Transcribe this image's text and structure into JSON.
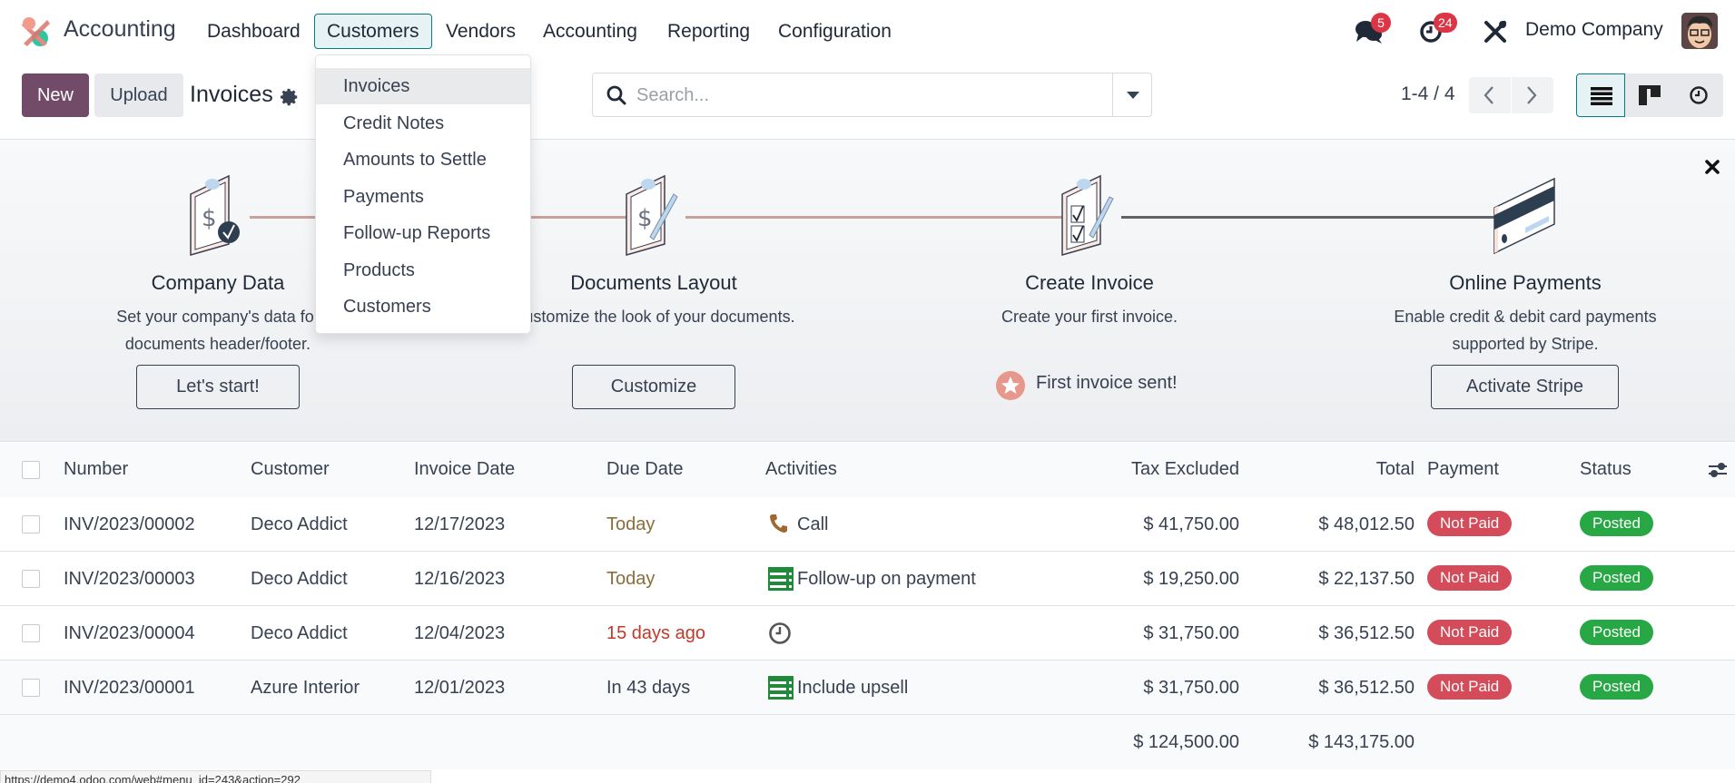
{
  "navbar": {
    "app_name": "Accounting",
    "menu": [
      {
        "label": "Dashboard",
        "active": false
      },
      {
        "label": "Customers",
        "active": true
      },
      {
        "label": "Vendors",
        "active": false
      },
      {
        "label": "Accounting",
        "active": false
      },
      {
        "label": "Reporting",
        "active": false
      },
      {
        "label": "Configuration",
        "active": false
      }
    ],
    "messages_icon": "chat-bubbles-icon",
    "messages_count": "5",
    "activities_icon": "clock-icon",
    "activities_count": "24",
    "debug_icon": "tools-icon",
    "company": "Demo Company"
  },
  "customers_menu": {
    "items": [
      {
        "label": "Invoices",
        "active": true
      },
      {
        "label": "Credit Notes"
      },
      {
        "label": "Amounts to Settle"
      },
      {
        "label": "Payments"
      },
      {
        "label": "Follow-up Reports"
      },
      {
        "label": "Products"
      },
      {
        "label": "Customers"
      }
    ]
  },
  "control_panel": {
    "new_label": "New",
    "upload_label": "Upload",
    "title": "Invoices",
    "search_placeholder": "Search...",
    "pager": "1-4 / 4",
    "views": [
      "list",
      "kanban",
      "activity"
    ]
  },
  "banner": {
    "steps": [
      {
        "title": "Company Data",
        "desc": "Set your company's data for documents header/footer.",
        "button": "Let's start!"
      },
      {
        "title": "Documents Layout",
        "desc": "Customize the look of your documents.",
        "button": "Customize"
      },
      {
        "title": "Create Invoice",
        "desc": "Create your first invoice.",
        "done": "First invoice sent!"
      },
      {
        "title": "Online Payments",
        "desc": "Enable credit & debit card payments supported by Stripe.",
        "button": "Activate Stripe"
      }
    ]
  },
  "table": {
    "columns": [
      "Number",
      "Customer",
      "Invoice Date",
      "Due Date",
      "Activities",
      "Tax Excluded",
      "Total",
      "Payment",
      "Status"
    ],
    "rows": [
      {
        "number": "INV/2023/00002",
        "customer": "Deco Addict",
        "invoice_date": "12/17/2023",
        "due_date": "Today",
        "due_state": "warning",
        "activity_icon": "phone-icon",
        "activity": "Call",
        "tax_excluded": "$ 41,750.00",
        "total": "$ 48,012.50",
        "payment": "Not Paid",
        "status": "Posted"
      },
      {
        "number": "INV/2023/00003",
        "customer": "Deco Addict",
        "invoice_date": "12/16/2023",
        "due_date": "Today",
        "due_state": "warning",
        "activity_icon": "todo-icon",
        "activity": "Follow-up on payment",
        "tax_excluded": "$ 19,250.00",
        "total": "$ 22,137.50",
        "payment": "Not Paid",
        "status": "Posted"
      },
      {
        "number": "INV/2023/00004",
        "customer": "Deco Addict",
        "invoice_date": "12/04/2023",
        "due_date": "15 days ago",
        "due_state": "danger",
        "activity_icon": "clock-icon",
        "activity": "",
        "tax_excluded": "$ 31,750.00",
        "total": "$ 36,512.50",
        "payment": "Not Paid",
        "status": "Posted"
      },
      {
        "number": "INV/2023/00001",
        "customer": "Azure Interior",
        "invoice_date": "12/01/2023",
        "due_date": "In 43 days",
        "due_state": "normal",
        "activity_icon": "todo-icon",
        "activity": "Include upsell",
        "tax_excluded": "$ 31,750.00",
        "total": "$ 36,512.50",
        "payment": "Not Paid",
        "status": "Posted"
      }
    ],
    "totals": {
      "tax_excluded": "$ 124,500.00",
      "total": "$ 143,175.00"
    }
  },
  "status_url": "https://demo4.odoo.com/web#menu_id=243&action=292",
  "colors": {
    "brand": "#714b67",
    "accent": "#017e84",
    "not_paid": "#d44c59",
    "posted": "#28a745"
  }
}
